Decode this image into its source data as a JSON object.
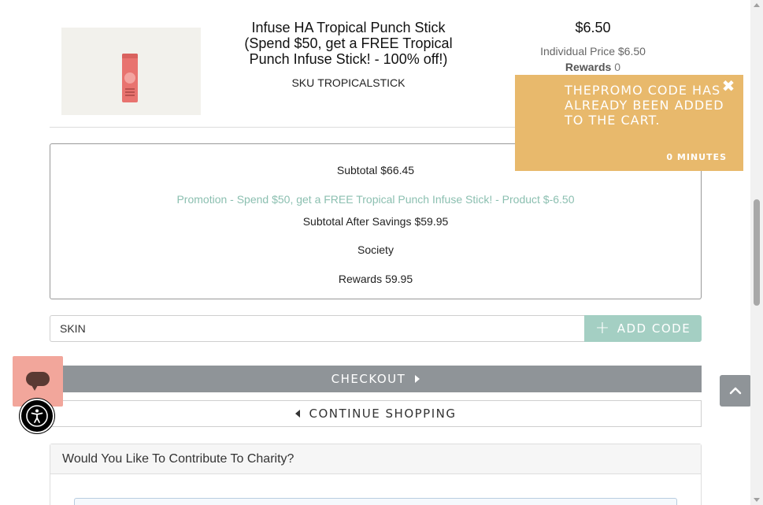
{
  "product": {
    "name": "Infuse HA Tropical Punch Stick (Spend $50, get a FREE Tropical Punch Infuse Stick! - 100% off!)",
    "sku_label": "SKU",
    "sku": "TROPICALSTICK",
    "price": "$6.50",
    "individual_price": "Individual Price $6.50",
    "rewards_label": "Rewards",
    "rewards_value": "0"
  },
  "summary": {
    "subtotal_label": "Subtotal",
    "subtotal_value": "$66.45",
    "promotion": "Promotion - Spend $50, get a FREE Tropical Punch Infuse Stick! - Product $-6.50",
    "after_savings_label": "Subtotal After Savings",
    "after_savings_value": "$59.95",
    "society": "Society",
    "rewards_label": "Rewards",
    "rewards_value": "59.95"
  },
  "promo": {
    "code_value": "SKIN",
    "add_code_label": "ADD CODE"
  },
  "actions": {
    "checkout_label": "CHECKOUT",
    "continue_label": "CONTINUE SHOPPING"
  },
  "charity": {
    "title": "Would You Like To Contribute To Charity?"
  },
  "toast": {
    "message": "THEPROMO CODE HAS ALREADY BEEN ADDED TO THE CART.",
    "time": "0 MINUTES",
    "close_icon": "close-icon"
  },
  "icons": {
    "chat": "chat-bubble-icon",
    "accessibility": "accessibility-icon",
    "back_to_top": "chevron-up-icon",
    "add": "plus-icon",
    "checkout_arrow": "caret-right-icon",
    "continue_arrow": "caret-left-icon"
  },
  "colors": {
    "toast_bg": "#e8b96c",
    "add_code_bg": "#a4cfc3",
    "checkout_bg": "#8f9498",
    "promotion_text": "#8bbfb0",
    "chat_bg": "#f2a69b"
  }
}
